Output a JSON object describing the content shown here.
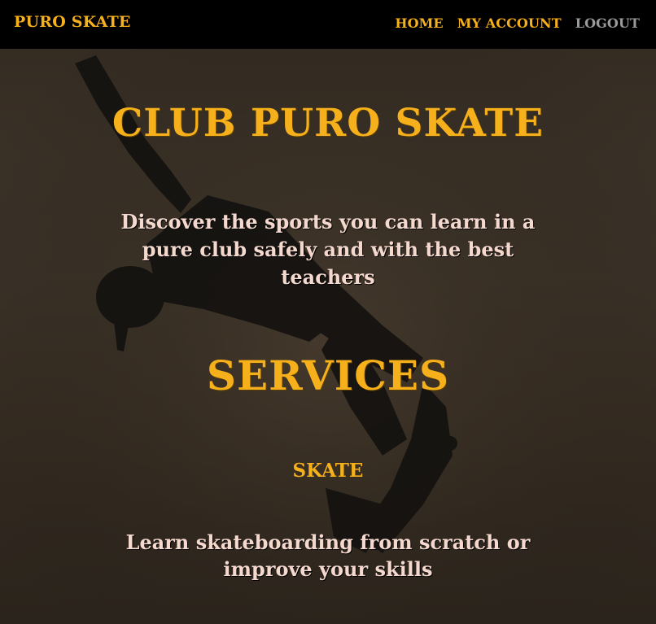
{
  "navbar": {
    "brand": "PURO SKATE",
    "links": [
      {
        "label": "HOME"
      },
      {
        "label": "MY ACCOUNT"
      },
      {
        "label": "LOGOUT"
      }
    ]
  },
  "hero": {
    "title": "CLUB PURO SKATE",
    "text": "Discover the sports you can learn in a pure club safely and with the best teachers"
  },
  "services": {
    "title": "SERVICES",
    "items": [
      {
        "title": "SKATE",
        "text": "Learn skateboarding from scratch or improve your skills"
      }
    ]
  },
  "colors": {
    "accent": "#f5b01b",
    "muted_link": "#9a9a9a",
    "body_text": "#f5d9ce",
    "navbar_bg": "#000000"
  }
}
